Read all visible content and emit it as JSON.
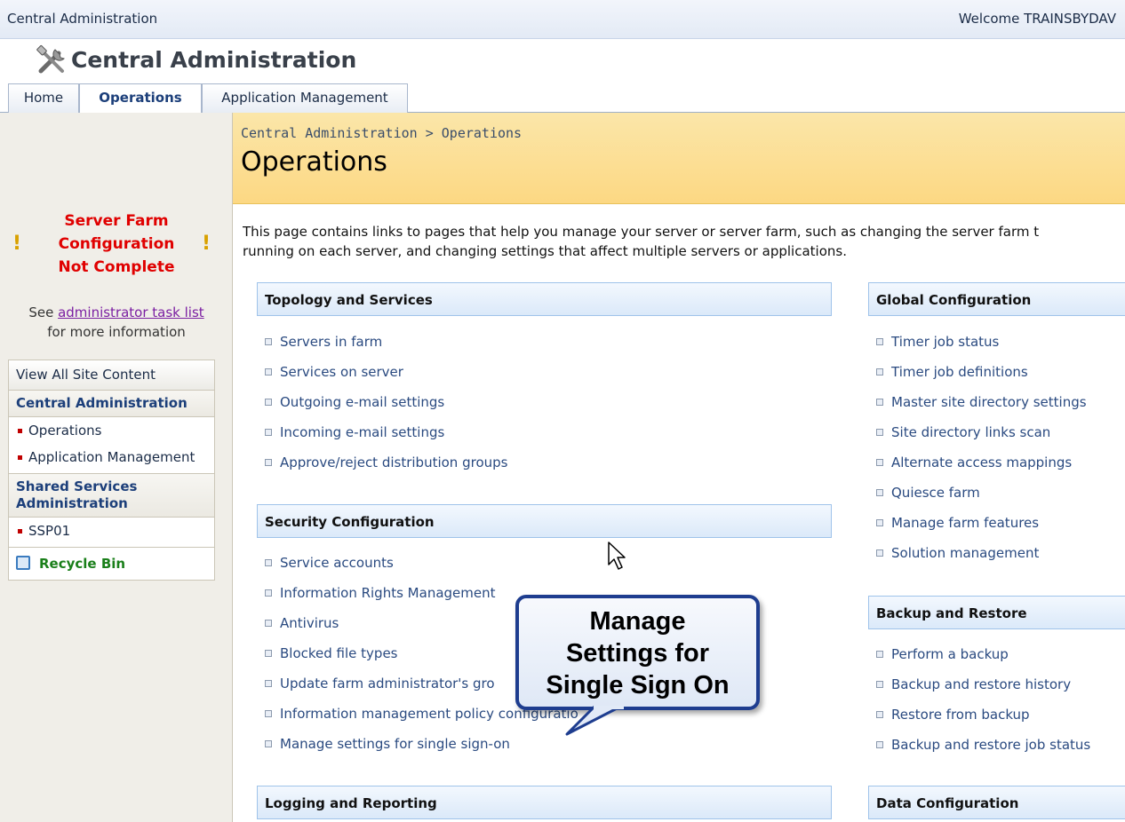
{
  "topbar": {
    "crumb": "Central Administration",
    "welcome": "Welcome TRAINSBYDAV"
  },
  "site": {
    "title": "Central Administration",
    "logo_icon": "tools-icon"
  },
  "tabs": [
    {
      "label": "Home",
      "active": false
    },
    {
      "label": "Operations",
      "active": true
    },
    {
      "label": "Application Management",
      "active": false
    }
  ],
  "warning": {
    "lines": [
      "Server Farm",
      "Configuration",
      "Not Complete"
    ],
    "see_prefix": "See",
    "see_link": "administrator task list",
    "see_suffix": "for more information"
  },
  "quicklaunch": {
    "view_all": "View All Site Content",
    "groups": [
      {
        "heading": "Central Administration",
        "items": [
          "Operations",
          "Application Management"
        ]
      },
      {
        "heading": "Shared Services Administration",
        "items": [
          "SSP01"
        ]
      }
    ],
    "recycle_bin": "Recycle Bin"
  },
  "page": {
    "breadcrumb": "Central Administration > Operations",
    "title": "Operations",
    "description": [
      "This page contains links to pages that help you manage your server or server farm, such as changing the server farm t",
      "running on each server, and changing settings that affect multiple servers or applications."
    ]
  },
  "sections": {
    "topology": {
      "heading": "Topology and Services",
      "links": [
        "Servers in farm",
        "Services on server",
        "Outgoing e-mail settings",
        "Incoming e-mail settings",
        "Approve/reject distribution groups"
      ]
    },
    "security": {
      "heading": "Security Configuration",
      "links": [
        "Service accounts",
        "Information Rights Management",
        "Antivirus",
        "Blocked file types",
        "Update farm administrator's gro",
        "Information management policy configuratio",
        "Manage settings for single sign-on"
      ]
    },
    "logging": {
      "heading": "Logging and Reporting"
    },
    "global": {
      "heading": "Global Configuration",
      "links": [
        "Timer job status",
        "Timer job definitions",
        "Master site directory settings",
        "Site directory links scan",
        "Alternate access mappings",
        "Quiesce farm",
        "Manage farm features",
        "Solution management"
      ]
    },
    "backup": {
      "heading": "Backup and Restore",
      "links": [
        "Perform a backup",
        "Backup and restore history",
        "Restore from backup",
        "Backup and restore job status"
      ]
    },
    "data": {
      "heading": "Data Configuration"
    }
  },
  "callout": {
    "lines": [
      "Manage",
      "Settings for",
      "Single Sign On"
    ]
  }
}
